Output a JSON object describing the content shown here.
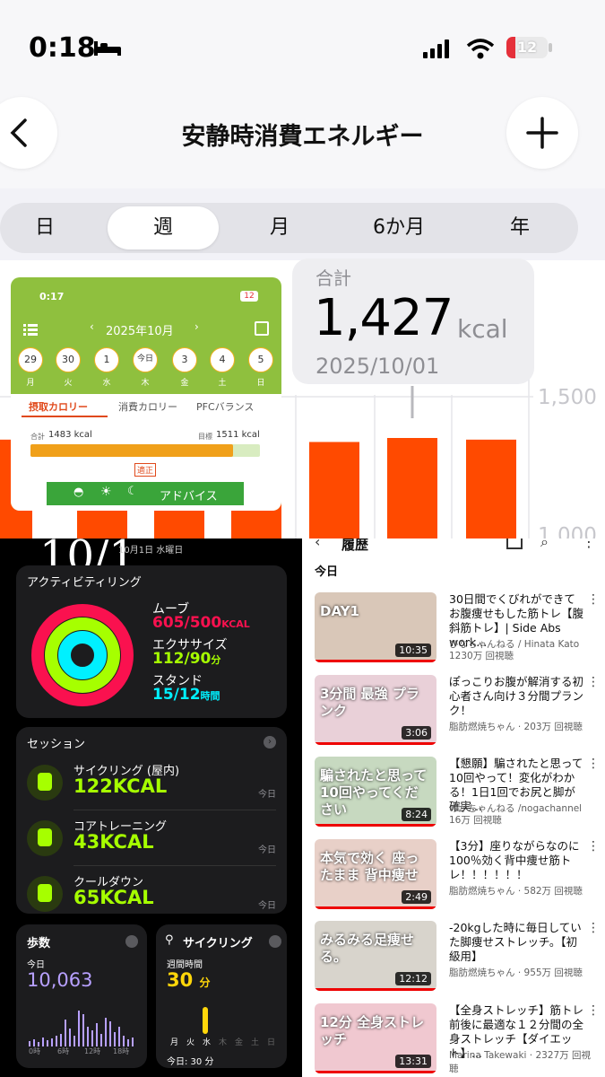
{
  "status_bar": {
    "time": "0:18",
    "battery": "12"
  },
  "nav": {
    "title": "安静時消費エネルギー"
  },
  "segments": [
    "日",
    "週",
    "月",
    "6か月",
    "年"
  ],
  "selected_segment": "週",
  "summary": {
    "label": "合計",
    "value": "1,427",
    "unit": "kcal",
    "date": "2025/10/01"
  },
  "axis_labels": {
    "top": "1,500",
    "bottom": "1,000"
  },
  "chart_data": {
    "type": "bar",
    "ylim": [
      1000,
      1500
    ],
    "values": [
      1420,
      1400,
      1405,
      1410,
      1410,
      1427,
      1420
    ],
    "selected_index": 5
  },
  "inset_app": {
    "time": "0:17",
    "battery": "12",
    "month": "2025年10月",
    "days": [
      {
        "n": "29",
        "d": "月"
      },
      {
        "n": "30",
        "d": "火"
      },
      {
        "n": "1",
        "d": "水"
      },
      {
        "n": "今日",
        "d": "木"
      },
      {
        "n": "3",
        "d": "金"
      },
      {
        "n": "4",
        "d": "土"
      },
      {
        "n": "5",
        "d": "日"
      }
    ],
    "tabs": [
      "摂取カロリー",
      "消費カロリー",
      "PFCバランス"
    ],
    "total_label": "合計",
    "total_value": "1483 kcal",
    "goal_label": "目標",
    "goal_value": "1511 kcal",
    "progress": 0.98,
    "status": "適正",
    "advice": "アドバイス"
  },
  "fitness": {
    "date_big": "10/1",
    "date_small": "10月1日 水曜日",
    "rings_title": "アクティビティリング",
    "move_label": "ムーブ",
    "move_value": "605/500",
    "move_unit": "KCAL",
    "exercise_label": "エクササイズ",
    "exercise_value": "112/90",
    "exercise_unit": "分",
    "stand_label": "スタンド",
    "stand_value": "15/12",
    "stand_unit": "時間",
    "move_color": "#fa114f",
    "exercise_color": "#a6ff00",
    "stand_color": "#00f0ff",
    "sessions_title": "セッション",
    "sessions": [
      {
        "name": "サイクリング (屋内)",
        "value": "122KCAL",
        "when": "今日"
      },
      {
        "name": "コアトレーニング",
        "value": "43KCAL",
        "when": "今日"
      },
      {
        "name": "クールダウン",
        "value": "65KCAL",
        "when": "今日"
      }
    ],
    "steps_title": "歩数",
    "steps_sub": "今日",
    "steps_value": "10,063",
    "steps_ticks": [
      "0時",
      "6時",
      "12時",
      "18時"
    ],
    "cycling_title": "サイクリング",
    "cycling_sub": "週間時間",
    "cycling_value": "30",
    "cycling_unit": "分",
    "cycling_days": [
      "月",
      "火",
      "水",
      "木",
      "金",
      "土",
      "日"
    ],
    "cycling_today": "今日: 30 分"
  },
  "youtube": {
    "title": "履歴",
    "section": "今日",
    "videos": [
      {
        "title": "30日間でくびれができてお腹痩せもした筋トレ【腹斜筋トレ】| Side Abs work...",
        "channel": "ひなちゃんねる / Hinata Kato",
        "views": "1230万 回視聴",
        "duration": "10:35",
        "thumb_text": "DAY1"
      },
      {
        "title": "ぽっこりお腹が解消する初心者さん向け３分間プランク！",
        "channel": "脂肪燃焼ちゃん · 203万 回視聴",
        "views": "",
        "duration": "3:06",
        "thumb_text": "3分間 最強 プランク"
      },
      {
        "title": "【懇願】騙されたと思って10回やって！変化がわかる！1日1回でお尻と脚が確実...",
        "channel": "のがちゃんねる /nogachannel",
        "views": "16万 回視聴",
        "duration": "8:24",
        "thumb_text": "騙されたと思って 10回やってください"
      },
      {
        "title": "【3分】座りながらなのに100％効く背中痩せ筋トレ！！！！！！",
        "channel": "脂肪燃焼ちゃん · 582万 回視聴",
        "views": "",
        "duration": "2:49",
        "thumb_text": "本気で効く 座ったまま 背中痩せ"
      },
      {
        "title": "-20kgした時に毎日していた脚痩せストレッチ。【初級用】",
        "channel": "脂肪燃焼ちゃん · 955万 回視聴",
        "views": "",
        "duration": "12:12",
        "thumb_text": "みるみる足痩せる。"
      },
      {
        "title": "【全身ストレッチ】筋トレ前後に最適な１２分間の全身ストレッチ【ダイエット】...",
        "channel": "Marina Takewaki · 2327万 回視聴",
        "views": "",
        "duration": "13:31",
        "thumb_text": "12分 全身ストレッチ"
      }
    ]
  }
}
